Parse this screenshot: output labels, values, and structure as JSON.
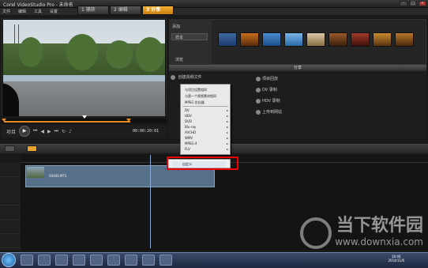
{
  "window": {
    "title": "Corel VideoStudio Pro - 未命名"
  },
  "menubar": {
    "items": [
      "文件",
      "编辑",
      "工具",
      "设置"
    ]
  },
  "steps": [
    {
      "label": "1 捕获"
    },
    {
      "label": "2 编辑"
    },
    {
      "label": "3 分享"
    }
  ],
  "player": {
    "mode_label": "项目",
    "mode_sub": "素材",
    "timecode": "00:00:20:01"
  },
  "library": {
    "side_items": [
      "添加",
      "样本",
      "浏览"
    ],
    "selected": "样本"
  },
  "share": {
    "header": "分享",
    "left_title": "创建视频文件",
    "right_items": [
      "项目回放",
      "DV 录制",
      "HDV 录制",
      "上传到网站"
    ]
  },
  "video_menu": {
    "items": [
      {
        "label": "与项目设置相同",
        "arrow": false
      },
      {
        "label": "与第一个视频素材相同",
        "arrow": false
      },
      {
        "label": "MPEG 优化器",
        "arrow": false
      },
      {
        "label": "DV",
        "arrow": true
      },
      {
        "label": "HDV",
        "arrow": true
      },
      {
        "label": "DVD",
        "arrow": true
      },
      {
        "label": "Blu-ray",
        "arrow": true
      },
      {
        "label": "AVCHD",
        "arrow": true
      },
      {
        "label": "WMV",
        "arrow": true
      },
      {
        "label": "MPEG-4",
        "arrow": true
      },
      {
        "label": "FLV",
        "arrow": true
      }
    ]
  },
  "custom_menu": {
    "label": "自定义"
  },
  "timeline": {
    "clip_name": "00400.MTS"
  },
  "taskbar": {
    "time": "16:46",
    "date": "2014/11/6"
  },
  "watermark": {
    "brand": "当下软件园",
    "url": "www.downxia.com"
  }
}
